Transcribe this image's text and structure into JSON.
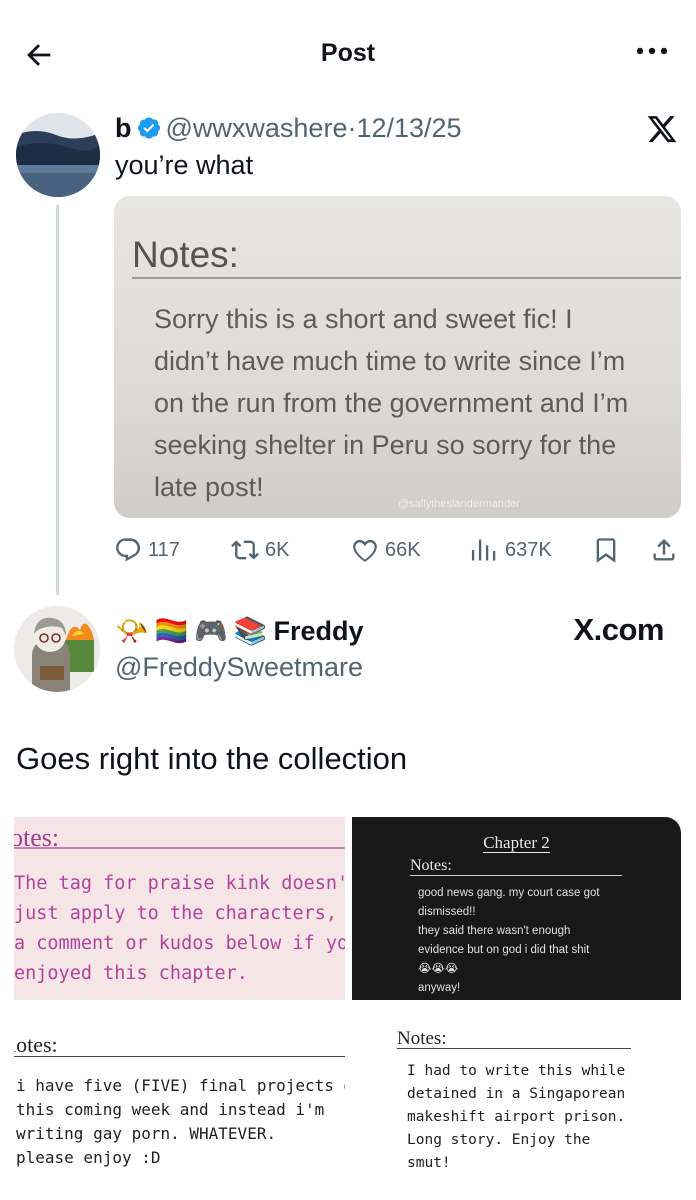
{
  "header": {
    "title": "Post"
  },
  "quoted_post": {
    "display_name": "b",
    "handle": "@wwxwashere",
    "separator": "·",
    "date": "12/13/25",
    "text": "you’re what",
    "image": {
      "heading": "Notes:",
      "lines": [
        "Sorry this is a short and sweet fic! I",
        "didn’t have much time to write since I’m",
        "on the run from the government and I’m",
        "seeking shelter in Peru so sorry for the",
        "late post!"
      ],
      "watermark": "@sallytheslandermander"
    },
    "metrics": {
      "replies": "117",
      "reposts": "6K",
      "likes": "66K",
      "views": "637K"
    }
  },
  "reply_post": {
    "emojis": [
      "📯",
      "🏳️‍🌈",
      "🎮",
      "📚"
    ],
    "display_name": "Freddy",
    "handle": "@FreddySweetmare",
    "source": "X.com",
    "text": "Goes right into the collection",
    "panels": {
      "top_left": {
        "heading": "otes:",
        "lines": [
          "The tag for praise kink doesn't",
          "just apply to the characters, drop",
          "a comment or kudos below if you",
          "enjoyed this chapter."
        ]
      },
      "top_right": {
        "chapter": "Chapter 2",
        "heading": "Notes:",
        "lines": [
          "good news gang. my court case got",
          "dismissed!!",
          "they said there wasn't enough",
          "evidence but on god i did that shit",
          "😭😭😭",
          "anyway!"
        ]
      },
      "bottom_left": {
        "heading": "lotes:",
        "lines": [
          "i have five (FIVE) final projects due",
          "this coming week and instead i'm",
          "writing gay porn. WHATEVER.",
          "please enjoy :D"
        ]
      },
      "bottom_right": {
        "heading": "Notes:",
        "lines": [
          "I had to write this while",
          "detained in a Singaporean",
          "makeshift airport prison.",
          "Long story. Enjoy the",
          "smut!"
        ]
      }
    }
  },
  "icons": [
    "back-arrow-icon",
    "more-icon",
    "verified-icon",
    "x-logo-icon",
    "reply-icon",
    "repost-icon",
    "like-icon",
    "views-icon",
    "bookmark-icon",
    "share-icon"
  ],
  "colors": {
    "text": "#0f1419",
    "secondary": "#536471",
    "verified": "#1d9bf0",
    "thread_line": "#cfd9de",
    "note_pink": "#b1439b"
  }
}
